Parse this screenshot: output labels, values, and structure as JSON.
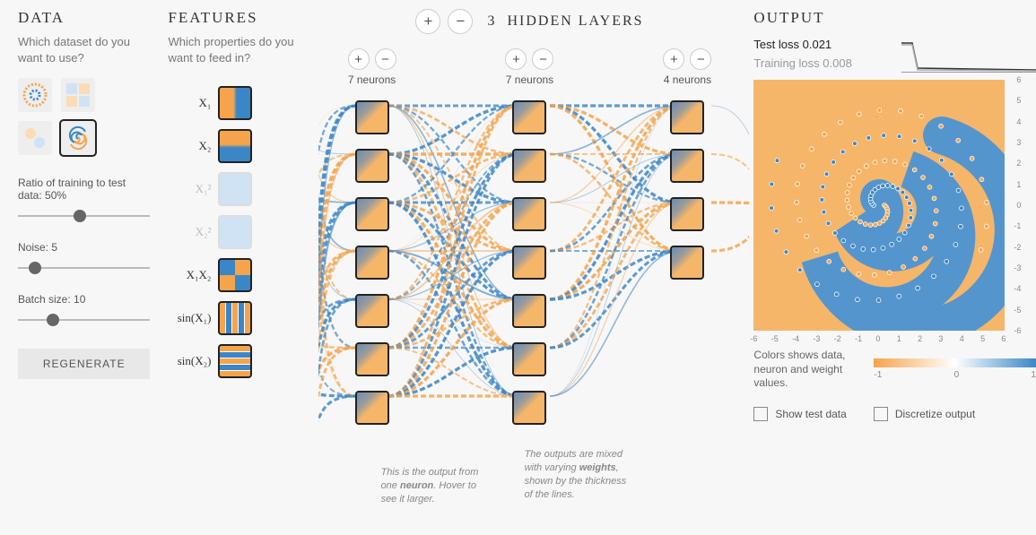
{
  "data": {
    "title": "DATA",
    "subtitle": "Which dataset do you want to use?",
    "datasets": [
      "circle",
      "xor",
      "gauss",
      "spiral"
    ],
    "selected_dataset": "spiral",
    "ratio_label": "Ratio of training to test data:  50%",
    "ratio_pct": 50,
    "noise_label": "Noise:  5",
    "noise_val": 5,
    "batch_label": "Batch size:  10",
    "batch_val": 10,
    "regen": "REGENERATE"
  },
  "features": {
    "title": "FEATURES",
    "subtitle": "Which properties do you want to feed in?",
    "items": [
      {
        "label": "X₁",
        "enabled": true,
        "cls": "g-h"
      },
      {
        "label": "X₂",
        "enabled": true,
        "cls": "g-v"
      },
      {
        "label": "X₁²",
        "enabled": false,
        "cls": "g-lb"
      },
      {
        "label": "X₂²",
        "enabled": false,
        "cls": "g-lb"
      },
      {
        "label": "X₁X₂",
        "enabled": true,
        "cls": "g-q"
      },
      {
        "label": "sin(X₁)",
        "enabled": true,
        "cls": "g-s1"
      },
      {
        "label": "sin(X₂)",
        "enabled": true,
        "cls": "g-s2"
      }
    ]
  },
  "network": {
    "add": "+",
    "remove": "−",
    "count_label": "3",
    "title": "HIDDEN LAYERS",
    "layers": [
      {
        "neurons": 7,
        "label": "7 neurons"
      },
      {
        "neurons": 7,
        "label": "7 neurons"
      },
      {
        "neurons": 4,
        "label": "4 neurons"
      }
    ],
    "callout1": "This is the output from one <b>neuron</b>. Hover to see it larger.",
    "callout2": "The outputs are mixed with varying <b>weights</b>, shown by the thickness of the lines."
  },
  "output": {
    "title": "OUTPUT",
    "test_loss_label": "Test loss",
    "test_loss": "0.021",
    "train_loss_label": "Training loss",
    "train_loss": "0.008",
    "axis_ticks": [
      "-6",
      "-5",
      "-4",
      "-3",
      "-2",
      "-1",
      "0",
      "1",
      "2",
      "3",
      "4",
      "5",
      "6"
    ],
    "legend_text": "Colors shows data, neuron and weight values.",
    "legend_min": "-1",
    "legend_mid": "0",
    "legend_max": "1",
    "show_test": "Show test data",
    "discretize": "Discretize output"
  }
}
